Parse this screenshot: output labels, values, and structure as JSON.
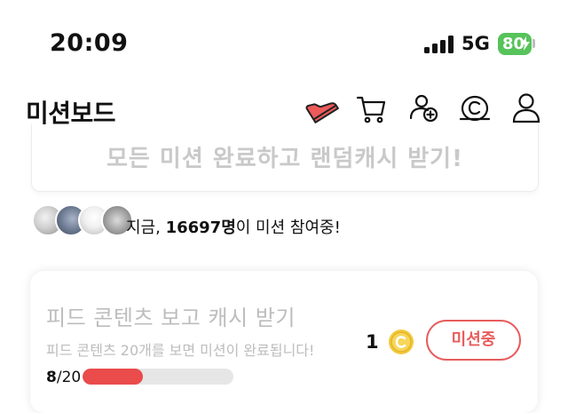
{
  "status_bar": {
    "time": "20:09",
    "network": "5G",
    "battery": "80",
    "battery_color": "#57c35b",
    "signal_icon": "signal-bars-icon",
    "battery_icon": "battery-charging-icon"
  },
  "header": {
    "title": "미션보드",
    "icons": [
      "shoe-icon",
      "cart-icon",
      "add-friend-icon",
      "cash-coin-icon",
      "profile-icon"
    ]
  },
  "banner": {
    "text": "모든 미션 완료하고 랜덤캐시 받기!"
  },
  "participants": {
    "prefix": "지금, ",
    "count": "16697명",
    "suffix": "이 미션 참여중!"
  },
  "mission": {
    "title": "피드 콘텐츠 보고 캐시 받기",
    "description": "피드 콘텐츠 20개를 보면 미션이 완료됩니다!",
    "reward": "1",
    "reward_icon": "coin-icon",
    "button_label": "미션중",
    "progress_done": "8",
    "progress_total": "/20",
    "progress_fraction": 0.4,
    "accent_color": "#ea4b4b"
  }
}
